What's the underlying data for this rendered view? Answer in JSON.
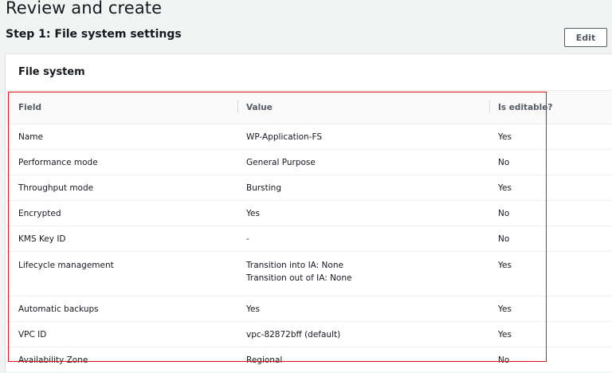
{
  "header": {
    "page_title": "Review and create",
    "step_title": "Step 1: File system settings",
    "edit_label": "Edit"
  },
  "panel": {
    "title": "File system",
    "columns": [
      "Field",
      "Value",
      "Is editable?"
    ],
    "rows": [
      {
        "field": "Name",
        "value": [
          "WP-Application-FS"
        ],
        "editable": "Yes"
      },
      {
        "field": "Performance mode",
        "value": [
          "General Purpose"
        ],
        "editable": "No"
      },
      {
        "field": "Throughput mode",
        "value": [
          "Bursting"
        ],
        "editable": "Yes"
      },
      {
        "field": "Encrypted",
        "value": [
          "Yes"
        ],
        "editable": "No"
      },
      {
        "field": "KMS Key ID",
        "value": [
          "-"
        ],
        "editable": "No"
      },
      {
        "field": "Lifecycle management",
        "value": [
          "Transition into IA: None",
          "Transition out of IA: None"
        ],
        "editable": "Yes"
      },
      {
        "field": "Automatic backups",
        "value": [
          "Yes"
        ],
        "editable": "Yes"
      },
      {
        "field": "VPC ID",
        "value": [
          "vpc-82872bff (default)"
        ],
        "editable": "Yes"
      },
      {
        "field": "Availability Zone",
        "value": [
          "Regional"
        ],
        "editable": "No"
      }
    ]
  },
  "colors": {
    "highlight": "#e0141e",
    "background": "#f2f3f3",
    "panel": "#ffffff"
  }
}
